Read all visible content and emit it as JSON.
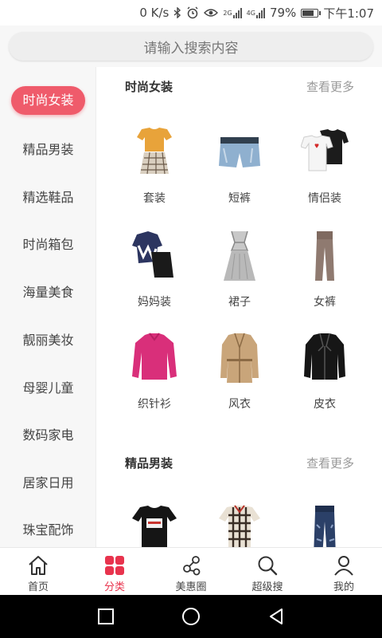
{
  "status": {
    "speed": "0 K/s",
    "net1": "2G",
    "net2": "4G",
    "battery": "79%",
    "time": "下午1:07",
    "battery_level": 0.79
  },
  "search": {
    "placeholder": "请输入搜索内容"
  },
  "sidebar": {
    "items": [
      {
        "label": "时尚女装",
        "active": true
      },
      {
        "label": "精品男装"
      },
      {
        "label": "精选鞋品"
      },
      {
        "label": "时尚箱包"
      },
      {
        "label": "海量美食"
      },
      {
        "label": "靓丽美妆"
      },
      {
        "label": "母婴儿童"
      },
      {
        "label": "数码家电"
      },
      {
        "label": "居家日用"
      },
      {
        "label": "珠宝配饰"
      }
    ]
  },
  "sections": [
    {
      "title": "时尚女装",
      "more": "查看更多",
      "items": [
        {
          "label": "套装",
          "icon": "outfit-set-icon"
        },
        {
          "label": "短裤",
          "icon": "shorts-icon"
        },
        {
          "label": "情侣装",
          "icon": "couple-tshirts-icon"
        },
        {
          "label": "妈妈装",
          "icon": "mom-outfit-icon"
        },
        {
          "label": "裙子",
          "icon": "dress-icon"
        },
        {
          "label": "女裤",
          "icon": "trousers-icon"
        },
        {
          "label": "织针衫",
          "icon": "sweater-icon"
        },
        {
          "label": "风衣",
          "icon": "trench-coat-icon"
        },
        {
          "label": "皮衣",
          "icon": "leather-jacket-icon"
        }
      ]
    },
    {
      "title": "精品男装",
      "more": "查看更多",
      "items": [
        {
          "label": "",
          "icon": "tshirt-icon"
        },
        {
          "label": "",
          "icon": "plaid-shirt-icon"
        },
        {
          "label": "",
          "icon": "jeans-icon"
        }
      ]
    }
  ],
  "tabbar": {
    "items": [
      {
        "label": "首页",
        "icon": "home-icon"
      },
      {
        "label": "分类",
        "icon": "category-grid-icon",
        "active": true
      },
      {
        "label": "美惠圈",
        "icon": "share-circle-icon"
      },
      {
        "label": "超级搜",
        "icon": "search-icon"
      },
      {
        "label": "我的",
        "icon": "user-icon"
      }
    ]
  },
  "colors": {
    "accent": "#ef5b6b",
    "tab_active": "#e8334d"
  }
}
